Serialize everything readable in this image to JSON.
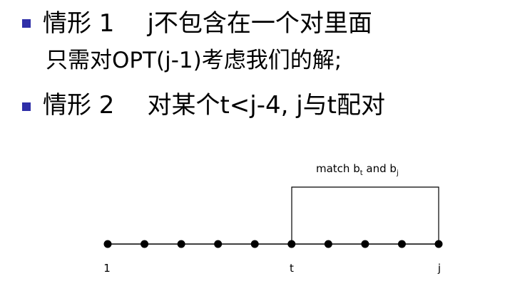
{
  "bullets": [
    {
      "tag": "情形 1",
      "text": "j不包含在一个对里面"
    },
    {
      "continuation": "只需对OPT(j-1)考虑我们的解;"
    },
    {
      "tag": "情形 2",
      "text": "对某个t<j-4, j与t配对"
    }
  ],
  "diagram": {
    "match_label": {
      "prefix": "match b",
      "sub1": "t",
      "mid": " and b",
      "sub2": "j"
    },
    "node_labels": [
      "1",
      "t",
      "j"
    ],
    "node_count": 10,
    "start_index": 1,
    "t_index": 6,
    "j_index": 10
  }
}
